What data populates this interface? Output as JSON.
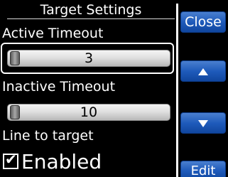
{
  "header": {
    "title": "Target Settings"
  },
  "fields": {
    "active_timeout": {
      "label": "Active Timeout",
      "value": "3"
    },
    "inactive_timeout": {
      "label": "Inactive Timeout",
      "value": "10"
    },
    "line_to_target": {
      "label": "Line to target",
      "checkbox_label": "Enabled",
      "checked": true
    }
  },
  "buttons": {
    "close": "Close",
    "up_icon": "up-arrow-icon",
    "down_icon": "down-arrow-icon",
    "edit": "Edit"
  },
  "colors": {
    "button_blue": "#1f5bbb",
    "background": "#000000"
  }
}
